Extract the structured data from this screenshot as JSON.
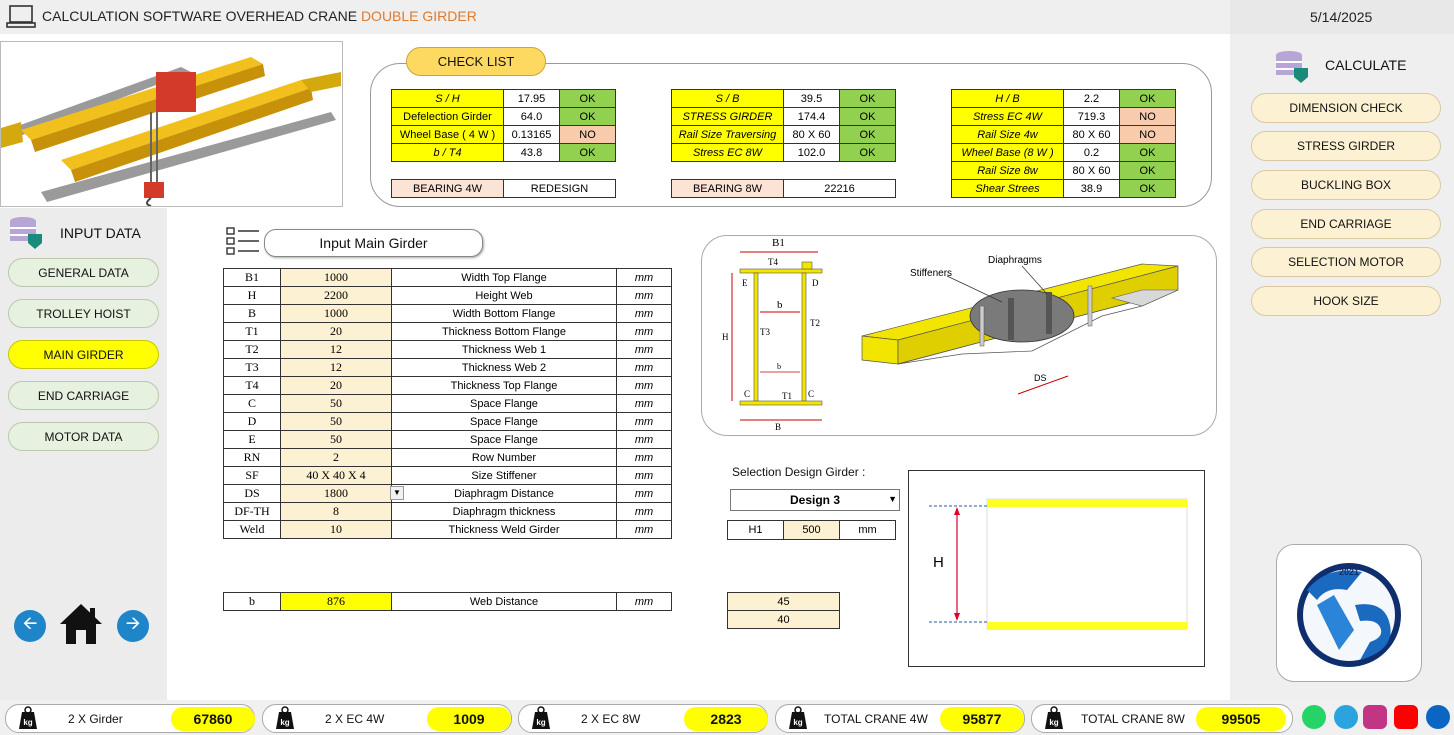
{
  "header": {
    "title_main": "CALCULATION SOFTWARE OVERHEAD CRANE ",
    "title_accent": "DOUBLE GIRDER",
    "date": "5/14/2025"
  },
  "left_sidebar": {
    "section_label": "INPUT DATA",
    "items": [
      {
        "label": "GENERAL DATA",
        "active": false
      },
      {
        "label": "TROLLEY HOIST",
        "active": false
      },
      {
        "label": "MAIN GIRDER",
        "active": true
      },
      {
        "label": "END CARRIAGE",
        "active": false
      },
      {
        "label": "MOTOR DATA",
        "active": false
      }
    ]
  },
  "right_sidebar": {
    "section_label": "CALCULATE",
    "items": [
      {
        "label": "DIMENSION CHECK"
      },
      {
        "label": "STRESS GIRDER"
      },
      {
        "label": "BUCKLING BOX"
      },
      {
        "label": "END CARRIAGE"
      },
      {
        "label": "SELECTION MOTOR"
      },
      {
        "label": "HOOK SIZE"
      }
    ],
    "logo_year": "2021"
  },
  "checklist": {
    "title": "CHECK LIST",
    "group1": [
      {
        "label": "S / H",
        "value": "17.95",
        "status": "OK"
      },
      {
        "label": "Defelection Girder",
        "value": "64.0",
        "status": "OK"
      },
      {
        "label": "Wheel Base ( 4 W )",
        "value": "0.13165",
        "status": "NO"
      },
      {
        "label": "b / T4",
        "value": "43.8",
        "status": "OK"
      }
    ],
    "group2": [
      {
        "label": "S / B",
        "value": "39.5",
        "status": "OK"
      },
      {
        "label": "STRESS GIRDER",
        "value": "174.4",
        "status": "OK"
      },
      {
        "label": "Rail Size Traversing",
        "value": "80 X 60",
        "status": "OK"
      },
      {
        "label": "Stress EC   8W",
        "value": "102.0",
        "status": "OK"
      }
    ],
    "group3": [
      {
        "label": "H / B",
        "value": "2.2",
        "status": "OK"
      },
      {
        "label": "Stress EC   4W",
        "value": "719.3",
        "status": "NO"
      },
      {
        "label": "Rail Size 4w",
        "value": "80 X 60",
        "status": "NO"
      },
      {
        "label": "Wheel Base (8 W )",
        "value": "0.2",
        "status": "OK"
      },
      {
        "label": "Rail Size 8w",
        "value": "80 X 60",
        "status": "OK"
      },
      {
        "label": "Shear Strees",
        "value": "38.9",
        "status": "OK"
      }
    ],
    "bearing4w": {
      "label": "BEARING 4W",
      "value": "REDESIGN"
    },
    "bearing8w": {
      "label": "BEARING 8W",
      "value": "22216"
    }
  },
  "input_girder": {
    "title": "Input Main Girder",
    "rows": [
      {
        "param": "B1",
        "value": "1000",
        "desc": "Width Top  Flange",
        "unit": "mm"
      },
      {
        "param": "H",
        "value": "2200",
        "desc": "Height Web",
        "unit": "mm"
      },
      {
        "param": "B",
        "value": "1000",
        "desc": "Width  Bottom  Flange",
        "unit": "mm"
      },
      {
        "param": "T1",
        "value": "20",
        "desc": "Thickness Bottom Flange",
        "unit": "mm"
      },
      {
        "param": "T2",
        "value": "12",
        "desc": "Thickness Web 1",
        "unit": "mm"
      },
      {
        "param": "T3",
        "value": "12",
        "desc": "Thickness Web 2",
        "unit": "mm"
      },
      {
        "param": "T4",
        "value": "20",
        "desc": "Thickness Top Flange",
        "unit": "mm"
      },
      {
        "param": "C",
        "value": "50",
        "desc": "Space Flange",
        "unit": "mm"
      },
      {
        "param": "D",
        "value": "50",
        "desc": "Space Flange",
        "unit": "mm"
      },
      {
        "param": "E",
        "value": "50",
        "desc": "Space Flange",
        "unit": "mm"
      },
      {
        "param": "RN",
        "value": "2",
        "desc": "Row Number",
        "unit": "mm"
      },
      {
        "param": "SF",
        "value": "40 X 40 X 4",
        "desc": "Size Stiffener",
        "unit": "mm"
      },
      {
        "param": "DS",
        "value": "1800",
        "desc": "Diaphragm Distance",
        "unit": "mm"
      },
      {
        "param": "DF-TH",
        "value": "8",
        "desc": "Diaphragm thickness",
        "unit": "mm"
      },
      {
        "param": "Weld",
        "value": "10",
        "desc": "Thickness Weld Girder",
        "unit": "mm"
      }
    ],
    "b_row": {
      "param": "b",
      "value": "876",
      "desc": "Web Distance",
      "unit": "mm"
    }
  },
  "diagram": {
    "labels": {
      "b1": "B1",
      "t4": "T4",
      "e": "E",
      "d": "D",
      "h": "H",
      "b_small": "b",
      "t3": "T3",
      "t2": "T2",
      "b_inner": "b",
      "c_left": "C",
      "t1": "T1",
      "c_right": "C",
      "b_bottom": "B",
      "stiffeners": "Stiffeners",
      "diaphragms": "Diaphragms",
      "ds": "DS"
    }
  },
  "design": {
    "selection_label": "Selection Design Girder :",
    "selected": "Design 3",
    "h1_label": "H1",
    "h1_value": "500",
    "h1_unit": "mm",
    "extra_values": [
      "45",
      "40"
    ],
    "h_label": "H"
  },
  "weights": [
    {
      "label": "2 X Girder",
      "value": "67860"
    },
    {
      "label": "2 X EC 4W",
      "value": "1009"
    },
    {
      "label": "2 X EC 8W",
      "value": "2823"
    },
    {
      "label": "TOTAL CRANE 4W",
      "value": "95877"
    },
    {
      "label": "TOTAL CRANE 8W",
      "value": "99505"
    }
  ],
  "kg_label": "kg",
  "colors": {
    "accent": "#e07a2c",
    "ok": "#92d050",
    "no": "#f8cbad",
    "highlight": "#ffff00"
  }
}
